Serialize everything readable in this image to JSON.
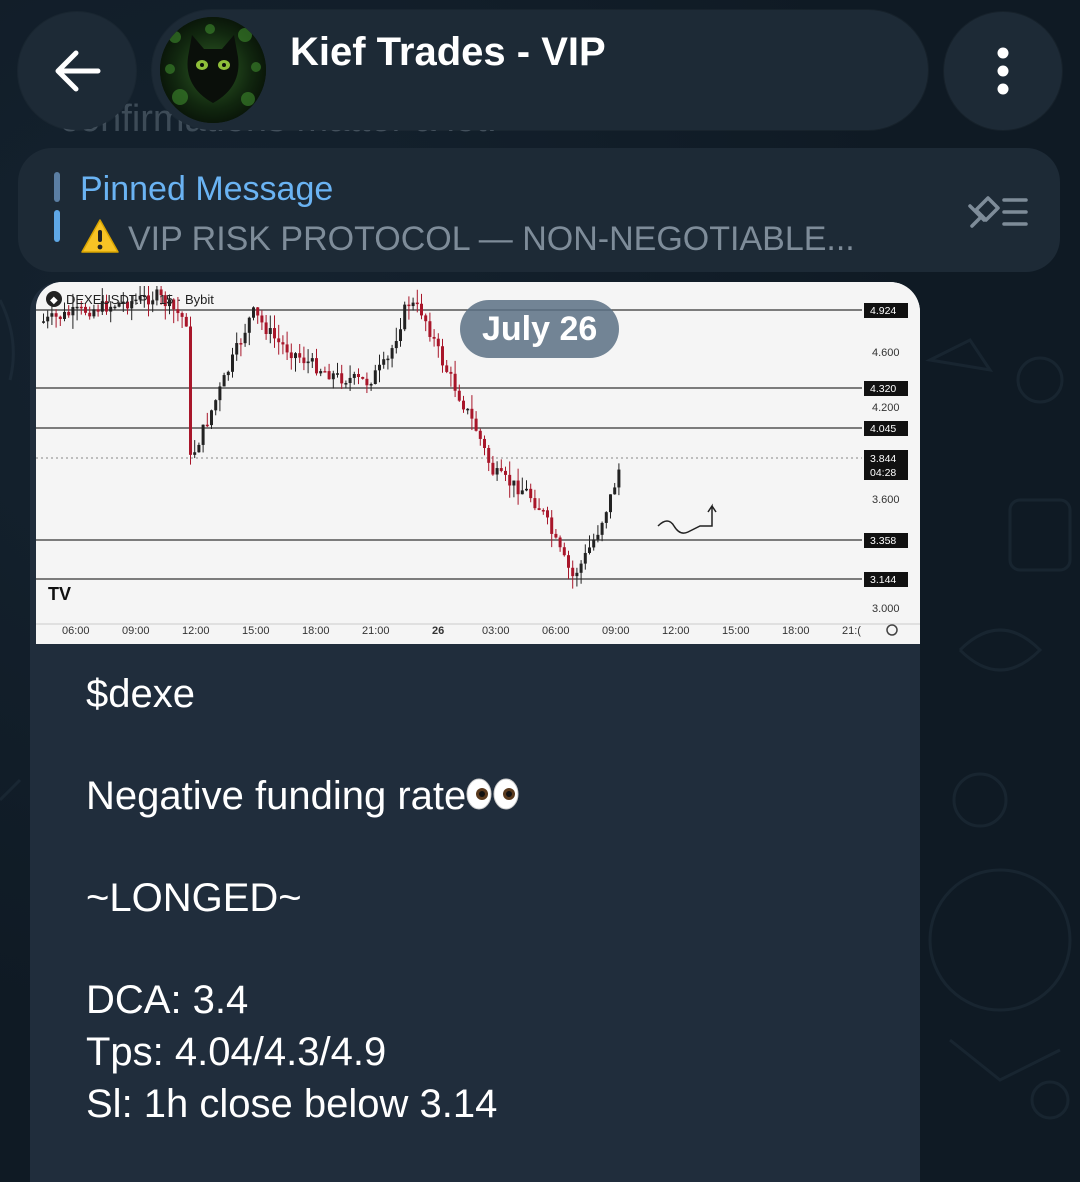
{
  "header": {
    "title": "Kief Trades - VIP",
    "behind_text": "confirmations matter a lot."
  },
  "pinned": {
    "label": "Pinned Message",
    "text": "VIP RISK PROTOCOL — NON-NEGOTIABLE..."
  },
  "date_chip": "July 26",
  "chart_image": {
    "symbol_label": "DEXEUSDT.P · 15 · Bybit",
    "price_labels": [
      "4.600",
      "4.200",
      "3.600",
      "3.000"
    ],
    "level_labels": [
      "4.924",
      "4.320",
      "4.045",
      "3.844",
      "04:28",
      "3.358",
      "3.144"
    ],
    "time_labels": [
      "06:00",
      "09:00",
      "12:00",
      "15:00",
      "18:00",
      "21:00",
      "26",
      "03:00",
      "06:00",
      "09:00",
      "12:00",
      "15:00",
      "18:00",
      "21:("
    ]
  },
  "message": {
    "line1": "$dexe",
    "line2": "Negative funding rate",
    "line3": "~LONGED~",
    "line4": "DCA: 3.4",
    "line5": "Tps: 4.04/4.3/4.9",
    "line6": "Sl: 1h close below 3.14"
  },
  "colors": {
    "accent": "#6ab3f3",
    "bubble": "#202d3c",
    "header": "#1d2a36",
    "candle_up": "#222222",
    "candle_down": "#a8162a"
  }
}
